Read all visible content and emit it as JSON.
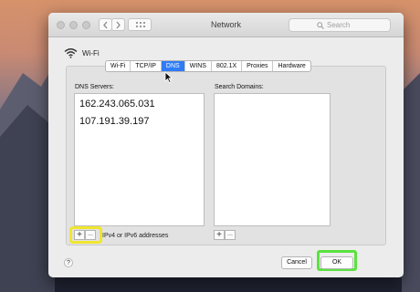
{
  "window": {
    "title": "Network"
  },
  "titlebar": {
    "back_icon": "chevron-left-icon",
    "forward_icon": "chevron-right-icon",
    "grid_icon": "grid-icon",
    "search_placeholder": "Search"
  },
  "interface": {
    "name": "Wi-Fi",
    "icon": "wifi-icon"
  },
  "tabs": [
    {
      "label": "Wi-Fi"
    },
    {
      "label": "TCP/IP"
    },
    {
      "label": "DNS"
    },
    {
      "label": "WINS"
    },
    {
      "label": "802.1X"
    },
    {
      "label": "Proxies"
    },
    {
      "label": "Hardware"
    }
  ],
  "active_tab": "DNS",
  "dns": {
    "servers_label": "DNS Servers:",
    "servers": [
      "162.243.065.031",
      "107.191.39.197"
    ],
    "add_label": "+",
    "remove_label": "–",
    "hint": "IPv4 or IPv6 addresses"
  },
  "search_domains": {
    "label": "Search Domains:",
    "add_label": "+",
    "remove_label": "–"
  },
  "footer": {
    "help_label": "?",
    "cancel_label": "Cancel",
    "ok_label": "OK"
  },
  "colors": {
    "accent": "#2f7cf6",
    "highlight_yellow": "#f1e62e",
    "highlight_green": "#5ae23e"
  }
}
